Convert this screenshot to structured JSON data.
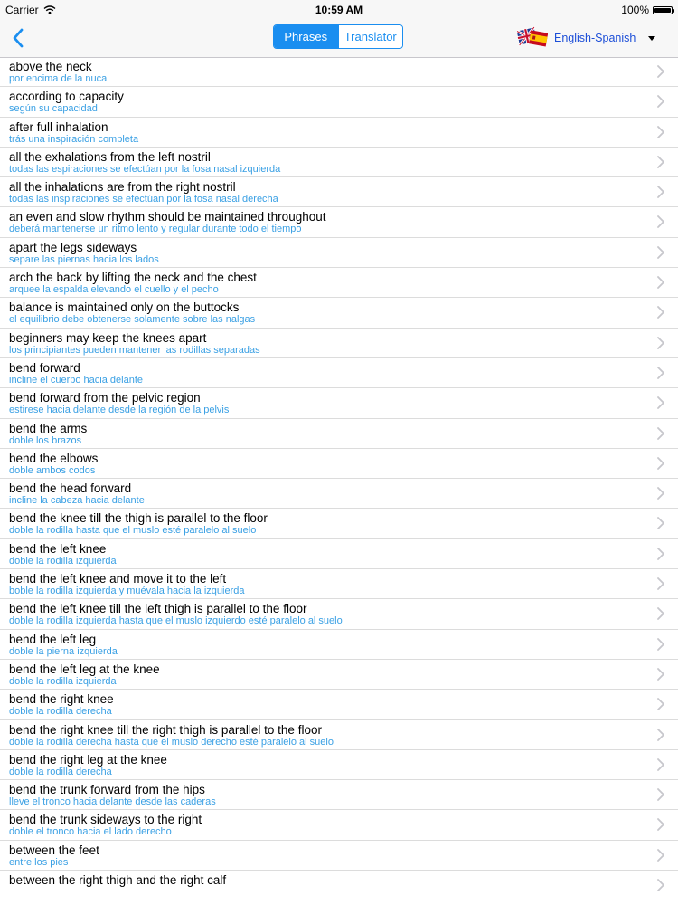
{
  "status_bar": {
    "carrier": "Carrier",
    "time": "10:59 AM",
    "battery": "100%"
  },
  "nav": {
    "tabs": [
      {
        "label": "Phrases",
        "active": true
      },
      {
        "label": "Translator",
        "active": false
      }
    ],
    "language": "English-Spanish",
    "icons": {
      "back": "chevron-left-icon",
      "flags": "uk-spain-flags-icon",
      "dropdown": "caret-down-icon"
    },
    "accent_color": "#1a8ef0"
  },
  "phrases": [
    {
      "en": "above the neck",
      "es": "por encima de la nuca"
    },
    {
      "en": "according to capacity",
      "es": "según su capacidad"
    },
    {
      "en": "after full inhalation",
      "es": "trás una inspiración completa"
    },
    {
      "en": "all the exhalations from the left nostril",
      "es": "todas las espiraciones se efectúan por la fosa nasal izquierda"
    },
    {
      "en": "all the inhalations are from the right nostril",
      "es": "todas las inspiraciones se efectúan por la fosa nasal derecha"
    },
    {
      "en": "an even and slow rhythm should be maintained throughout",
      "es": "deberá mantenerse un ritmo lento y regular durante todo el tiempo"
    },
    {
      "en": "apart the legs sideways",
      "es": "separe las piernas hacia los lados"
    },
    {
      "en": "arch the back by lifting the neck and the chest",
      "es": "arquee la espalda elevando el cuello y el pecho"
    },
    {
      "en": "balance is maintained only on the buttocks",
      "es": "el equilibrio debe obtenerse solamente sobre las nalgas"
    },
    {
      "en": "beginners may keep the knees apart",
      "es": "los principiantes pueden mantener las rodillas separadas"
    },
    {
      "en": "bend forward",
      "es": "incline el cuerpo hacia delante"
    },
    {
      "en": "bend forward from the pelvic region",
      "es": "estirese hacia delante desde la región de la pelvis"
    },
    {
      "en": "bend the arms",
      "es": "doble los brazos"
    },
    {
      "en": "bend the elbows",
      "es": "doble ambos codos"
    },
    {
      "en": "bend the head forward",
      "es": "incline la cabeza hacia delante"
    },
    {
      "en": "bend the knee till the thigh is parallel to the floor",
      "es": "doble la rodilla hasta que el muslo esté paralelo al suelo"
    },
    {
      "en": "bend the left knee",
      "es": "doble la rodilla izquierda"
    },
    {
      "en": "bend the left knee and move it to the left",
      "es": "boble la rodilla izquierda y muévala hacia la izquierda"
    },
    {
      "en": "bend the left knee till the left thigh is parallel to the floor",
      "es": "doble la rodilla izquierda hasta que el muslo izquierdo esté paralelo al suelo"
    },
    {
      "en": "bend the left leg",
      "es": "doble la pierna izquierda"
    },
    {
      "en": "bend the left leg at the knee",
      "es": "doble la rodilla izquierda"
    },
    {
      "en": "bend the right knee",
      "es": "doble la rodilla derecha"
    },
    {
      "en": "bend the right knee till the right thigh is parallel to the floor",
      "es": "doble la rodilla derecha hasta que el muslo derecho esté paralelo al suelo"
    },
    {
      "en": "bend the right leg at the knee",
      "es": "doble la rodilla derecha"
    },
    {
      "en": "bend the trunk forward from the hips",
      "es": "lleve el tronco hacia delante desde las caderas"
    },
    {
      "en": "bend the trunk sideways to the right",
      "es": "doble el tronco hacia el lado derecho"
    },
    {
      "en": "between the feet",
      "es": "entre los pies"
    },
    {
      "en": "between the right thigh and the right calf",
      "es": ""
    }
  ]
}
